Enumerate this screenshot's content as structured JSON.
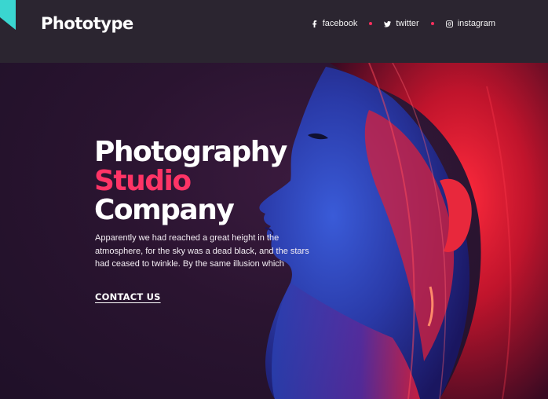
{
  "brand": {
    "logo_text": "Phototype",
    "accent_color": "#ff3466",
    "corner_color": "#3ad6d0"
  },
  "social": [
    {
      "icon": "facebook-icon",
      "label": "facebook"
    },
    {
      "icon": "twitter-icon",
      "label": "twitter"
    },
    {
      "icon": "instagram-icon",
      "label": "instagram"
    }
  ],
  "hero": {
    "title_line1": "Photography",
    "title_line2": "Studio",
    "title_line3": "Company",
    "description": "Apparently we had reached a great height in the atmosphere, for the sky was a dead black, and the stars had ceased to twinkle. By the same illusion which",
    "cta_label": "CONTACT US"
  }
}
